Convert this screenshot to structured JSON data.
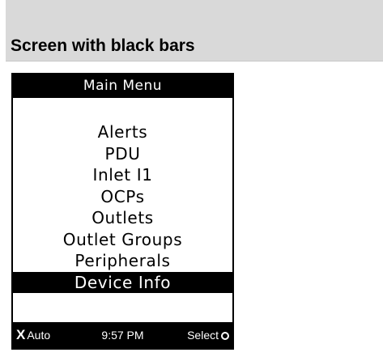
{
  "section": {
    "title": "Screen with black bars"
  },
  "device": {
    "title_bar": "Main Menu",
    "menu_items": [
      {
        "label": "Alerts",
        "selected": false
      },
      {
        "label": "PDU",
        "selected": false
      },
      {
        "label": "Inlet I1",
        "selected": false
      },
      {
        "label": "OCPs",
        "selected": false
      },
      {
        "label": "Outlets",
        "selected": false
      },
      {
        "label": "Outlet Groups",
        "selected": false
      },
      {
        "label": "Peripherals",
        "selected": false
      },
      {
        "label": "Device Info",
        "selected": true
      }
    ],
    "status_bar": {
      "left_icon": "x-icon",
      "left_label": "Auto",
      "time": "9:57 PM",
      "right_label": "Select",
      "right_icon": "circle-select-icon"
    }
  },
  "colors": {
    "header_background": "#d9d9d9",
    "screen_bar": "#000000",
    "screen_background": "#ffffff"
  }
}
